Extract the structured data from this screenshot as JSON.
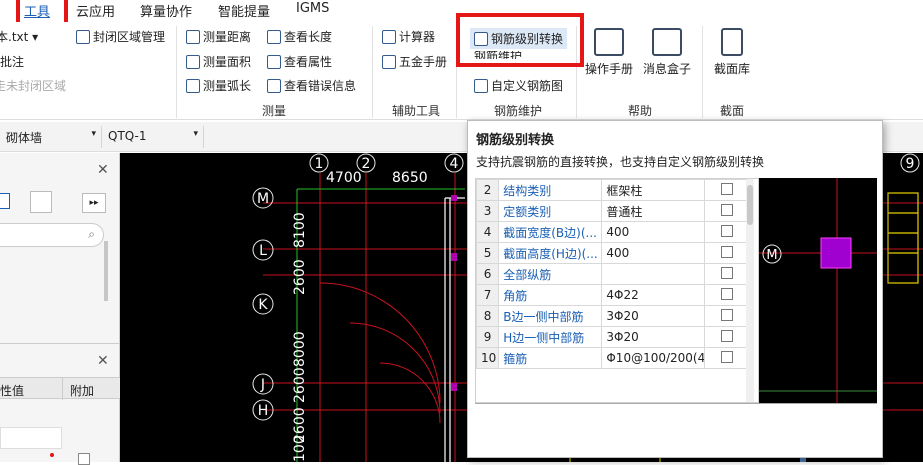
{
  "tabs": [
    {
      "label": "工具",
      "active": true
    },
    {
      "label": "云应用"
    },
    {
      "label": "算量协作"
    },
    {
      "label": "智能提量"
    },
    {
      "label": "IGMS"
    }
  ],
  "ribbon": {
    "partial_left": [
      "本.txt ▾",
      "批注",
      "走未封闭区域"
    ],
    "closed_area_mgmt": "封闭区域管理",
    "measure_distance": "测量距离",
    "measure_area": "测量面积",
    "measure_arc": "测量弧长",
    "view_length": "查看长度",
    "view_property": "查看属性",
    "view_error": "查看错误信息",
    "group_measure": "测量",
    "calculator": "计算器",
    "hardware_manual": "五金手册",
    "group_aux": "辅助工具",
    "rebar_grade_convert": "钢筋级别转换",
    "rebar_hidden": "钢筋维护",
    "custom_rebar": "自定义钢筋图",
    "group_rebar": "钢筋维护",
    "manual": "操作手册",
    "message_box": "消息盒子",
    "group_help": "帮助",
    "section_lib": "截面库",
    "group_section": "截面"
  },
  "toolbar2": {
    "combo1": "砌体墙",
    "combo2": "QTQ-1"
  },
  "left_panel": {
    "col_value": "性值",
    "col_extra": "附加"
  },
  "canvas": {
    "axis_top": [
      "1",
      "2",
      "4",
      "9"
    ],
    "axis_left": [
      "M",
      "L",
      "K",
      "J",
      "H"
    ],
    "dims_top": [
      "4700",
      "8650"
    ],
    "dims_left": [
      "8100",
      "2600",
      "8000",
      "2600",
      "2600",
      "100"
    ]
  },
  "popup": {
    "title": "钢筋级别转换",
    "description": "支持抗震钢筋的直接转换，也支持自定义钢筋级别转换",
    "rows": [
      {
        "n": "2",
        "name": "结构类别",
        "value": "框架柱"
      },
      {
        "n": "3",
        "name": "定额类别",
        "value": "普通柱"
      },
      {
        "n": "4",
        "name": "截面宽度(B边)(...",
        "value": "400"
      },
      {
        "n": "5",
        "name": "截面高度(H边)(...",
        "value": "400"
      },
      {
        "n": "6",
        "name": "全部纵筋",
        "value": ""
      },
      {
        "n": "7",
        "name": "角筋",
        "value": "4Φ22"
      },
      {
        "n": "8",
        "name": "B边一侧中部筋",
        "value": "3Φ20"
      },
      {
        "n": "9",
        "name": "H边一侧中部筋",
        "value": "3Φ20"
      },
      {
        "n": "10",
        "name": "箍筋",
        "value": "Φ10@100/200(4"
      }
    ],
    "preview_axis": "M"
  },
  "colors": {
    "accent": "#1a5fb4",
    "highlight_box": "#e51616",
    "canvas_bg": "#000000"
  }
}
